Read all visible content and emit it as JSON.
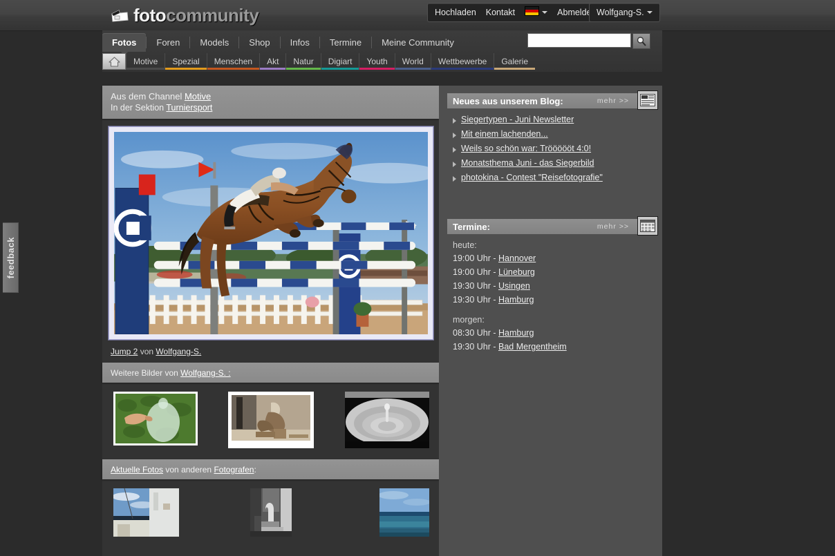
{
  "site": {
    "logo_primary": "foto",
    "logo_secondary": "community",
    "logo_icon": "camera-icon"
  },
  "topnav": {
    "items": [
      {
        "label": "Hochladen",
        "name": "hochladen"
      },
      {
        "label": "Kontakt",
        "name": "kontakt"
      }
    ],
    "language_icon": "german-flag-icon",
    "logout_label": "Abmelden",
    "user_label": "Wolfgang-S."
  },
  "mainnav": {
    "tabs": [
      {
        "label": "Fotos",
        "active": true
      },
      {
        "label": "Foren",
        "active": false
      },
      {
        "label": "Models",
        "active": false
      },
      {
        "label": "Shop",
        "active": false
      },
      {
        "label": "Infos",
        "active": false
      },
      {
        "label": "Termine",
        "active": false
      },
      {
        "label": "Meine Community",
        "active": false
      }
    ],
    "search": {
      "value": "",
      "placeholder": "",
      "button_icon": "magnifier-icon"
    }
  },
  "subnav": {
    "home_icon": "home-icon",
    "items": [
      {
        "label": "Motive",
        "color": "#4a4a4a"
      },
      {
        "label": "Spezial",
        "color": "#e39b1c"
      },
      {
        "label": "Menschen",
        "color": "#c4571f"
      },
      {
        "label": "Akt",
        "color": "#9b7bc4"
      },
      {
        "label": "Natur",
        "color": "#63b84a"
      },
      {
        "label": "Digiart",
        "color": "#149a96"
      },
      {
        "label": "Youth",
        "color": "#d61e63"
      },
      {
        "label": "World",
        "color": "#4a5f8c"
      },
      {
        "label": "Wettbewerbe",
        "color": "#2b3a7a"
      },
      {
        "label": "Galerie",
        "color": "#c9a878"
      }
    ]
  },
  "feedback": {
    "label": "feedback"
  },
  "channel": {
    "line1_prefix": "Aus dem Channel ",
    "line1_link": "Motive",
    "line2_prefix": "In der Sektion ",
    "line2_link": "Turniersport"
  },
  "main_photo": {
    "alt": "Springreiter auf braunem Pferd beim Sprung ueber ein blau-weisses Hindernis",
    "title": "Jump 2",
    "by_word": "von",
    "author": "Wolfgang-S."
  },
  "more_images": {
    "prefix": "Weitere Bilder von ",
    "author_link": "Wolfgang-S. :",
    "thumbs": [
      {
        "alt": "Hand mit Wasserballon vor gruenem Gras"
      },
      {
        "alt": "Sepia Skulptur an Hauswand"
      },
      {
        "alt": "Wassertropfen mit Wellenringen"
      }
    ]
  },
  "recent_photos": {
    "link1": "Aktuelle Fotos",
    "middle": " von anderen ",
    "link2": "Fotografen",
    "suffix": ":",
    "thumbs": [
      {
        "alt": "Weisses Gebaeude vor blauem Himmel"
      },
      {
        "alt": "Schwarzweiss Industrie Detailaufnahme"
      },
      {
        "alt": "Blaues Meer mit Horizont"
      }
    ]
  },
  "blog_panel": {
    "title": "Neues aus unserem Blog:",
    "more_label": "mehr >>",
    "icon": "newspaper-icon",
    "items": [
      "Siegertypen - Juni Newsletter",
      "Mit einem lachenden...",
      "Weils so schön war: Tröööööt 4:0!",
      "Monatsthema Juni - das Siegerbild",
      "photokina - Contest \"Reisefotografie\""
    ]
  },
  "termine_panel": {
    "title": "Termine:",
    "more_label": "mehr >>",
    "icon": "calendar-icon",
    "groups": [
      {
        "label": "heute:",
        "entries": [
          {
            "time": "19:00 Uhr - ",
            "city": "Hannover"
          },
          {
            "time": "19:00 Uhr - ",
            "city": "Lüneburg"
          },
          {
            "time": "19:30 Uhr - ",
            "city": "Usingen"
          },
          {
            "time": "19:30 Uhr - ",
            "city": "Hamburg"
          }
        ]
      },
      {
        "label": "morgen:",
        "entries": [
          {
            "time": "08:30 Uhr - ",
            "city": "Hamburg"
          },
          {
            "time": "19:30 Uhr - ",
            "city": "Bad Mergentheim"
          }
        ]
      }
    ]
  },
  "colors": {
    "page_bg": "#2b2b2b",
    "content_bg": "#3a3a3a",
    "panel_header": "#8a8a8a",
    "right_col_bg": "#4f4f4f",
    "link": "#ececec"
  }
}
